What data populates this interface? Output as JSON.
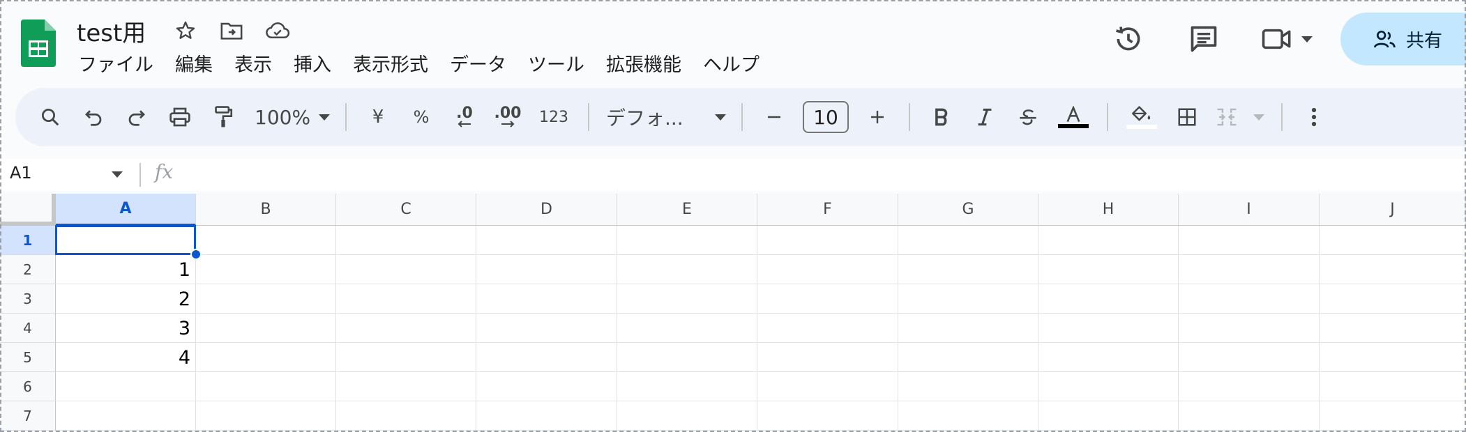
{
  "title": "test用",
  "menu": [
    "ファイル",
    "編集",
    "表示",
    "挿入",
    "表示形式",
    "データ",
    "ツール",
    "拡張機能",
    "ヘルプ"
  ],
  "share_label": "共有",
  "toolbar": {
    "zoom": "100%",
    "currency": "¥",
    "percent": "%",
    "dec_decrease": ".0",
    "dec_increase": ".00",
    "more_formats": "123",
    "font": "デフォ...",
    "font_size": "10"
  },
  "namebox": "A1",
  "fx": "fx",
  "columns": [
    "A",
    "B",
    "C",
    "D",
    "E",
    "F",
    "G",
    "H",
    "I",
    "J"
  ],
  "rows": [
    "1",
    "2",
    "3",
    "4",
    "5",
    "6",
    "7"
  ],
  "cells": [
    {
      "ref": "A2",
      "value": "1"
    },
    {
      "ref": "A3",
      "value": "2"
    },
    {
      "ref": "A4",
      "value": "3"
    },
    {
      "ref": "A5",
      "value": "4"
    }
  ],
  "selected_cell": "A1",
  "icons": [
    "sheets-logo",
    "star-icon",
    "move-to-folder-icon",
    "cloud-saved-icon",
    "history-icon",
    "comment-icon",
    "meet-icon",
    "people-icon",
    "search-icon",
    "undo-icon",
    "redo-icon",
    "print-icon",
    "paint-format-icon",
    "bold-icon",
    "italic-icon",
    "strikethrough-icon",
    "text-color-icon",
    "fill-color-icon",
    "borders-icon",
    "merge-icon",
    "more-vert-icon"
  ],
  "colors": {
    "accent": "#0b57d0",
    "share_bg": "#c2e7ff",
    "toolbar_bg": "#edf2fa",
    "sheets_green": "#0f9d58"
  }
}
